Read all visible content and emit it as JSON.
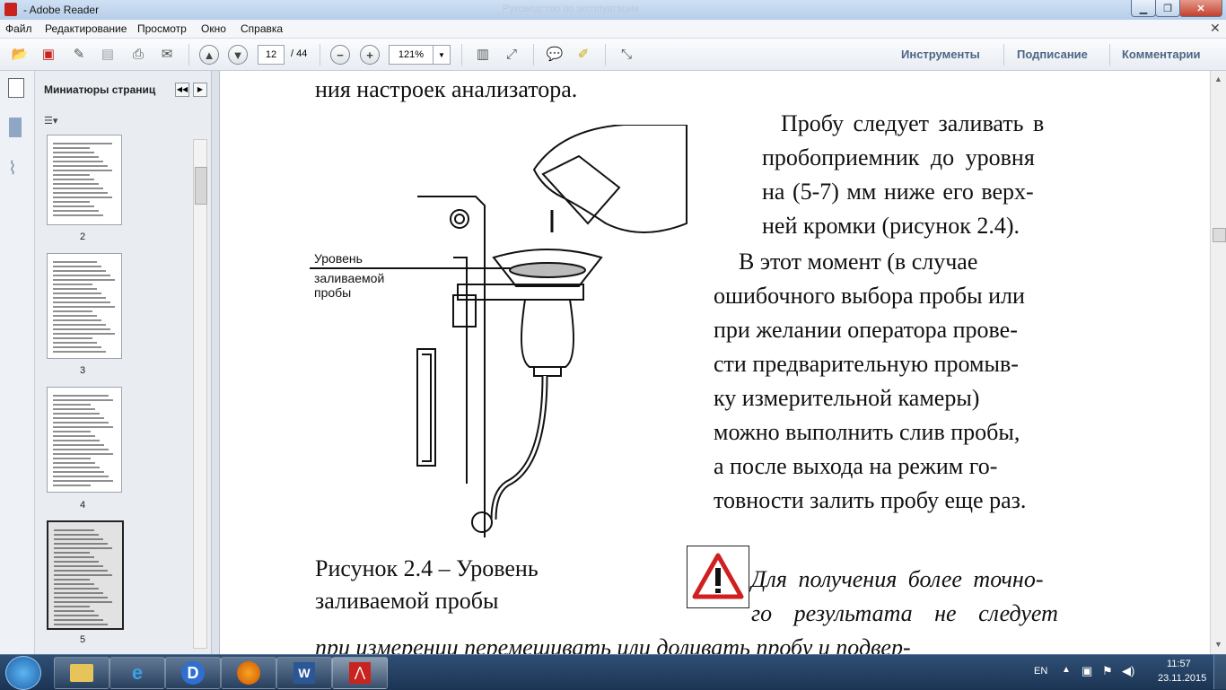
{
  "window": {
    "title": "- Adobe Reader",
    "faded_title": "Руководство по эксплуатации"
  },
  "menu": [
    "Файл",
    "Редактирование",
    "Просмотр",
    "Окно",
    "Справка"
  ],
  "toolbar": {
    "page_current": "12",
    "page_total": "/ 44",
    "zoom": "121%",
    "tabs": [
      "Инструменты",
      "Подписание",
      "Комментарии"
    ]
  },
  "sidebar": {
    "panel_title": "Миниатюры страниц",
    "pages": [
      "2",
      "3",
      "4",
      "5"
    ]
  },
  "document": {
    "line_top": "ния настроек анализатора.",
    "para1": [
      "Пробу следует заливать в",
      "пробоприемник до уровня",
      "на (5-7) мм ниже его верх-",
      "ней кромки (рисунок 2.4)."
    ],
    "para2": [
      "В этот момент (в случае",
      "ошибочного выбора пробы или",
      "при желании оператора прове-",
      "сти предварительную промыв-",
      "ку измерительной камеры)",
      "можно выполнить слив пробы,",
      "а после выхода на режим го-",
      "товности залить пробу еще раз."
    ],
    "figure_labels": [
      "Уровень",
      "заливаемой",
      "пробы"
    ],
    "caption": [
      "Рисунок 2.4 – Уровень",
      "заливаемой пробы"
    ],
    "warning": [
      "Для получения более точно-",
      "го результата не следует",
      "при измерении перемешивать или доливать пробу и подвер-"
    ]
  },
  "taskbar": {
    "lang": "EN",
    "time": "11:57",
    "date": "23.11.2015"
  }
}
